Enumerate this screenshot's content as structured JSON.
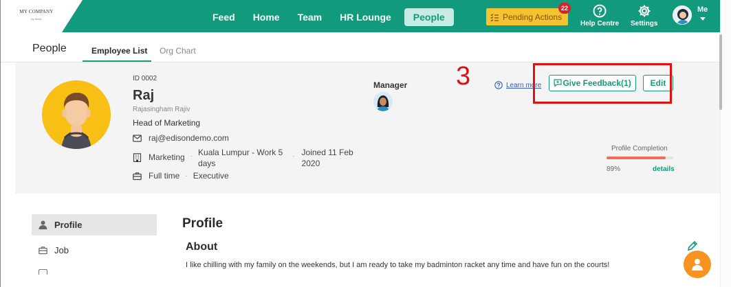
{
  "brand": {
    "logo_main": "MY COMPANY",
    "logo_sub": "by reeze"
  },
  "nav": {
    "items": [
      {
        "label": "Feed"
      },
      {
        "label": "Home"
      },
      {
        "label": "Team"
      },
      {
        "label": "HR Lounge"
      },
      {
        "label": "People"
      }
    ],
    "active": "People"
  },
  "topbar": {
    "pending_label": "Pending Actions",
    "pending_count": "22",
    "help_label": "Help Centre",
    "settings_label": "Settings",
    "me_label": "Me"
  },
  "page": {
    "title": "People",
    "tabs": [
      {
        "label": "Employee List"
      },
      {
        "label": "Org Chart"
      }
    ]
  },
  "employee": {
    "id": "ID 0002",
    "name": "Raj",
    "full_name": "Rajasingham Rajiv",
    "title": "Head of Marketing",
    "email": "raj@edisondemo.com",
    "department": "Marketing",
    "location_line1": "Kuala Lumpur - Work 5",
    "location_line2": "days",
    "joined_line1": "Joined 11 Feb",
    "joined_line2": "2020",
    "employment_type": "Full time",
    "level": "Executive"
  },
  "manager": {
    "label": "Manager"
  },
  "annotation": {
    "step": "3"
  },
  "actions": {
    "learn_more": "Learn more",
    "give_feedback": "Give Feedback(1)",
    "edit": "Edit"
  },
  "profile_completion": {
    "label": "Profile Completion",
    "value_text": "89%",
    "value": 0.89,
    "details": "details"
  },
  "sidenav": {
    "items": [
      {
        "label": "Profile"
      },
      {
        "label": "Job"
      }
    ]
  },
  "main": {
    "heading": "Profile",
    "about_heading": "About",
    "about_text": "I like chilling with my family on the weekends, but I am ready to take my badminton racket any time and have fun on the courts!"
  },
  "colors": {
    "brand": "#129a7c",
    "pending": "#f4c430",
    "badge": "#d9222a",
    "progress": "#f26d60",
    "annotation": "#e01010",
    "fab": "#f7931e"
  }
}
